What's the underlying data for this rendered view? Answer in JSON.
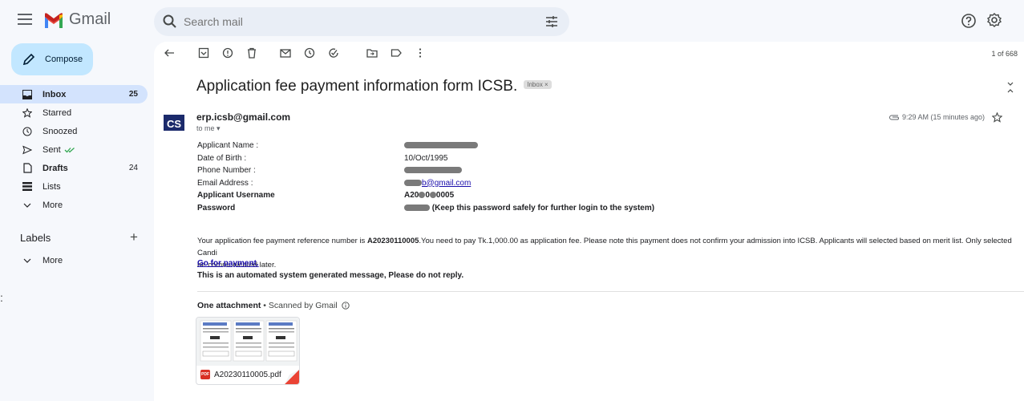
{
  "app": {
    "name": "Gmail"
  },
  "search": {
    "placeholder": "Search mail"
  },
  "compose": {
    "label": "Compose"
  },
  "sidebar": {
    "items": [
      {
        "label": "Inbox",
        "count": "25",
        "icon": "inbox-icon"
      },
      {
        "label": "Starred",
        "count": "",
        "icon": "star-icon"
      },
      {
        "label": "Snoozed",
        "count": "",
        "icon": "clock-icon"
      },
      {
        "label": "Sent",
        "count": "",
        "icon": "send-icon"
      },
      {
        "label": "Drafts",
        "count": "24",
        "icon": "file-icon"
      },
      {
        "label": "Lists",
        "count": "",
        "icon": "list-icon"
      },
      {
        "label": "More",
        "count": "",
        "icon": "chevron-down-icon"
      }
    ],
    "labels_heading": "Labels",
    "labels_plus": "+",
    "labels_more": "More"
  },
  "toolbar": {
    "pager": "1 of 668"
  },
  "email": {
    "subject": "Application fee payment information form ICSB.",
    "inbox_chip": "Inbox ×",
    "sender": "erp.icsb@gmail.com",
    "to": "to me ▾",
    "time": "9:29 AM (15 minutes ago)",
    "fields": [
      {
        "label": "Applicant Name :",
        "value": ""
      },
      {
        "label": "Date of Birth :",
        "value": "10/Oct/1995"
      },
      {
        "label": "Phone Number :",
        "value": ""
      },
      {
        "label": "Email Address :",
        "value": "b@gmail.com"
      },
      {
        "label": "Applicant Username",
        "value_a": "A20",
        "value_b": "0",
        "value_c": "0005"
      },
      {
        "label": "Password",
        "value": "(Keep this password safely for further login to the system)"
      }
    ],
    "para_a": "Your application fee payment reference number is ",
    "para_ref": "A20230110005",
    "para_b": ".You need to pay Tk.1,000.00 as application fee. Please note this payment does not confirm your admission into ICSB. Applicants will selected based on merit list. Only selected Candi",
    "para_c": "be communicated later.",
    "pay_link": "Go for payment.",
    "auto_msg": "This is an automated system generated message, Please do not reply.",
    "attachments_heading": "One attachment",
    "scanned": " • Scanned by Gmail",
    "attachment_name": "A20230110005.pdf",
    "pdf_badge": "PDF"
  }
}
